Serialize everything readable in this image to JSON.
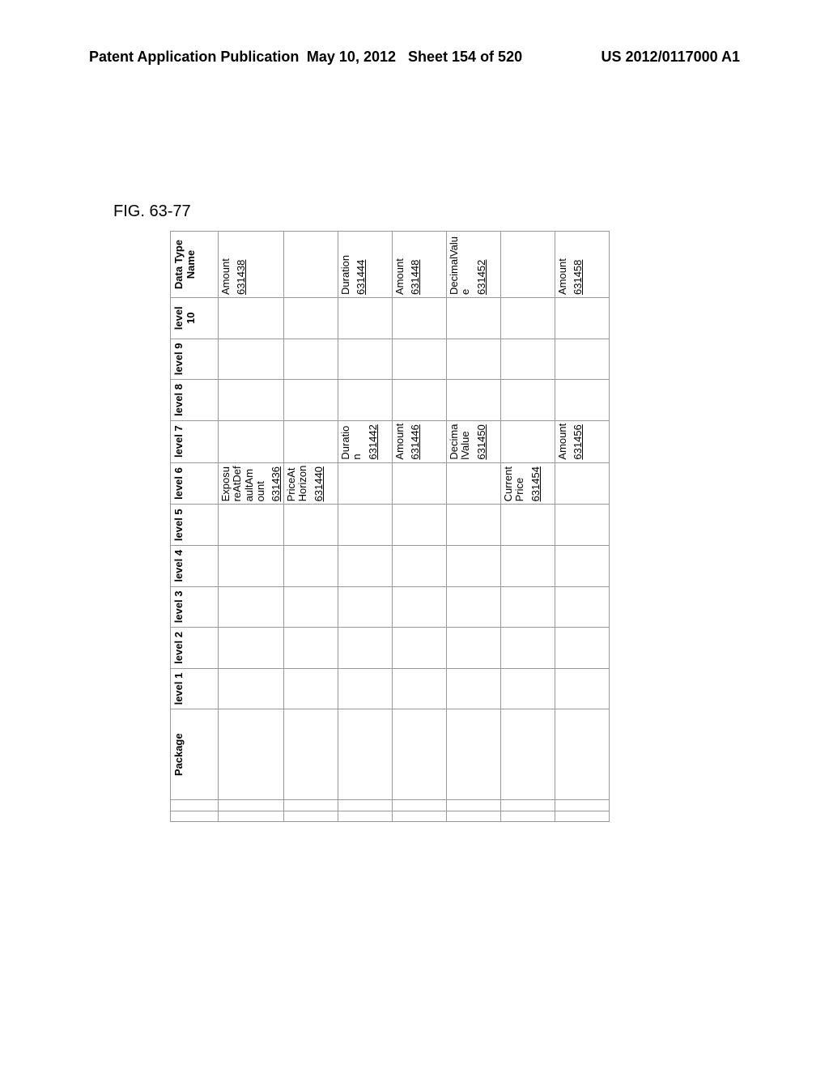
{
  "header": {
    "left": "Patent Application Publication",
    "date": "May 10, 2012",
    "sheet": "Sheet 154 of 520",
    "pubno": "US 2012/0117000 A1"
  },
  "figure_label": "FIG. 63-77",
  "columns": {
    "package": "Package",
    "levels": [
      "level 1",
      "level 2",
      "level 3",
      "level 4",
      "level 5",
      "level 6",
      "level 7",
      "level 8",
      "level 9",
      "level 10"
    ],
    "data_type_name": "Data Type Name"
  },
  "rows": [
    {
      "level6": {
        "text": "ExposureAtDefaultAmount",
        "ref": "631436"
      },
      "level7": null,
      "dtn": {
        "text": "Amount",
        "ref": "631438"
      }
    },
    {
      "level6": {
        "text": "PriceAtHorizon",
        "ref": "631440"
      },
      "level7": null,
      "dtn": null
    },
    {
      "level6": null,
      "level7": {
        "text": "Duration",
        "ref": "631442"
      },
      "dtn": {
        "text": "Duration",
        "ref": "631444"
      }
    },
    {
      "level6": null,
      "level7": {
        "text": "Amount",
        "ref": "631446"
      },
      "dtn": {
        "text": "Amount",
        "ref": "631448"
      }
    },
    {
      "level6": null,
      "level7": {
        "text": "DecimalValue",
        "ref": "631450"
      },
      "dtn": {
        "text": "DecimalValue",
        "ref": "631452"
      }
    },
    {
      "level6": {
        "text": "CurrentPrice",
        "ref": "631454"
      },
      "level7": null,
      "dtn": null
    },
    {
      "level6": null,
      "level7": {
        "text": "Amount",
        "ref": "631456"
      },
      "dtn": {
        "text": "Amount",
        "ref": "631458"
      }
    }
  ]
}
